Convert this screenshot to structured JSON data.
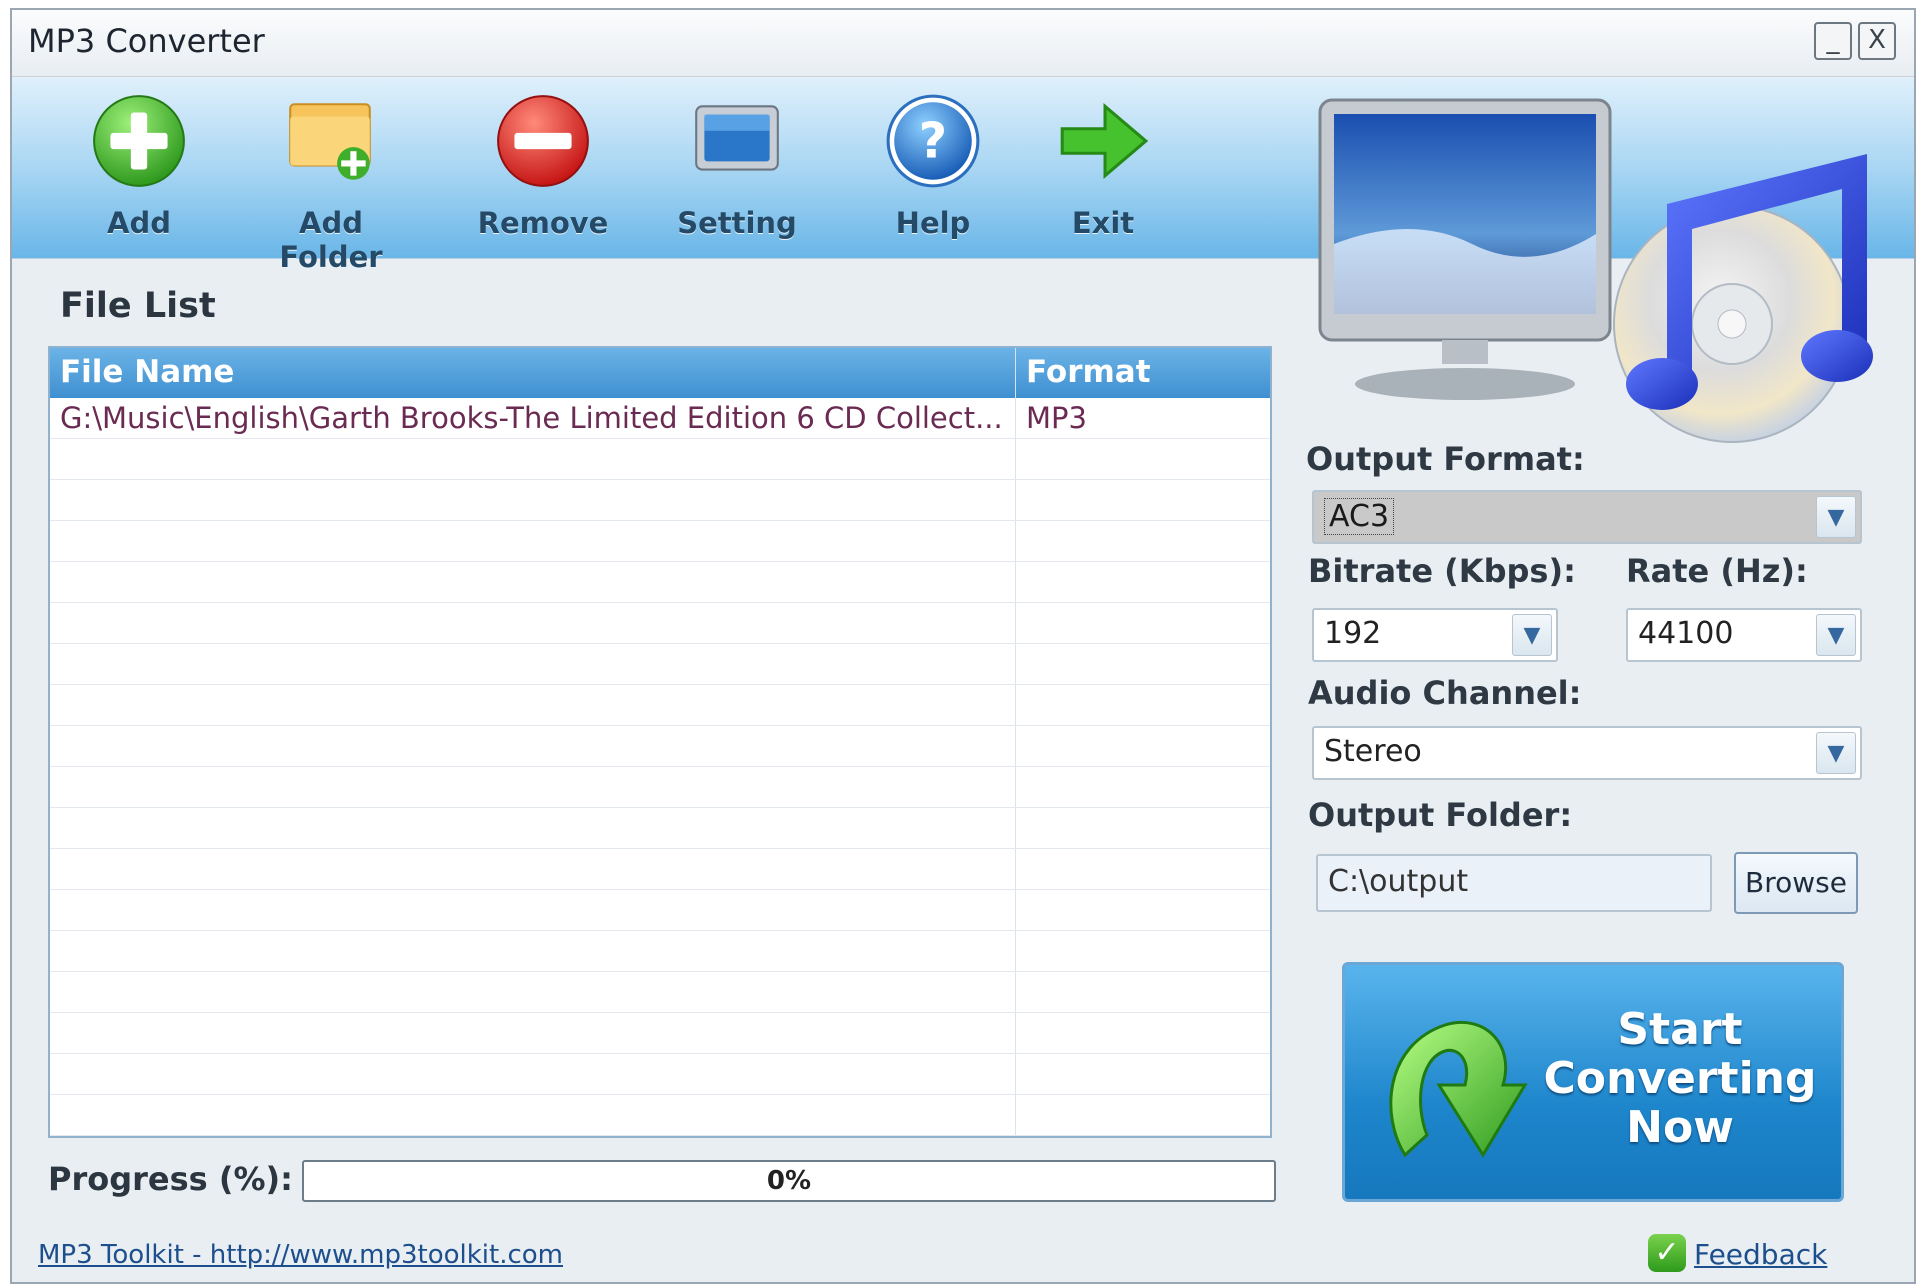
{
  "window": {
    "title": "MP3 Converter",
    "minimize_glyph": "_",
    "close_glyph": "X"
  },
  "toolbar": {
    "items": [
      {
        "label": "Add",
        "icon": "add-icon"
      },
      {
        "label": "Add Folder",
        "icon": "add-folder-icon"
      },
      {
        "label": "Remove",
        "icon": "remove-icon"
      },
      {
        "label": "Setting",
        "icon": "setting-icon"
      },
      {
        "label": "Help",
        "icon": "help-icon"
      },
      {
        "label": "Exit",
        "icon": "exit-icon"
      }
    ]
  },
  "file_list": {
    "title": "File List",
    "columns": [
      "File Name",
      "Format"
    ],
    "rows": [
      {
        "file_name": "G:\\Music\\English\\Garth Brooks-The Limited Edition 6 CD Collect...",
        "format": "MP3"
      }
    ]
  },
  "progress": {
    "label": "Progress (%):",
    "value": 0,
    "text": "0%"
  },
  "settings": {
    "output_format_label": "Output Format:",
    "output_format_value": "AC3",
    "bitrate_label": "Bitrate (Kbps):",
    "bitrate_value": "192",
    "rate_label": "Rate (Hz):",
    "rate_value": "44100",
    "channel_label": "Audio Channel:",
    "channel_value": "Stereo",
    "folder_label": "Output Folder:",
    "folder_value": "C:\\output",
    "browse_label": "Browse"
  },
  "start_button": {
    "line1": "Start",
    "line2": "Converting",
    "line3": "Now"
  },
  "footer": {
    "link_text": "MP3 Toolkit - http://www.mp3toolkit.com",
    "feedback_text": "Feedback"
  },
  "colors": {
    "accent": "#3f8fd0",
    "toolbar_bottom": "#69b6e8",
    "start_button": "#1e86cc"
  }
}
